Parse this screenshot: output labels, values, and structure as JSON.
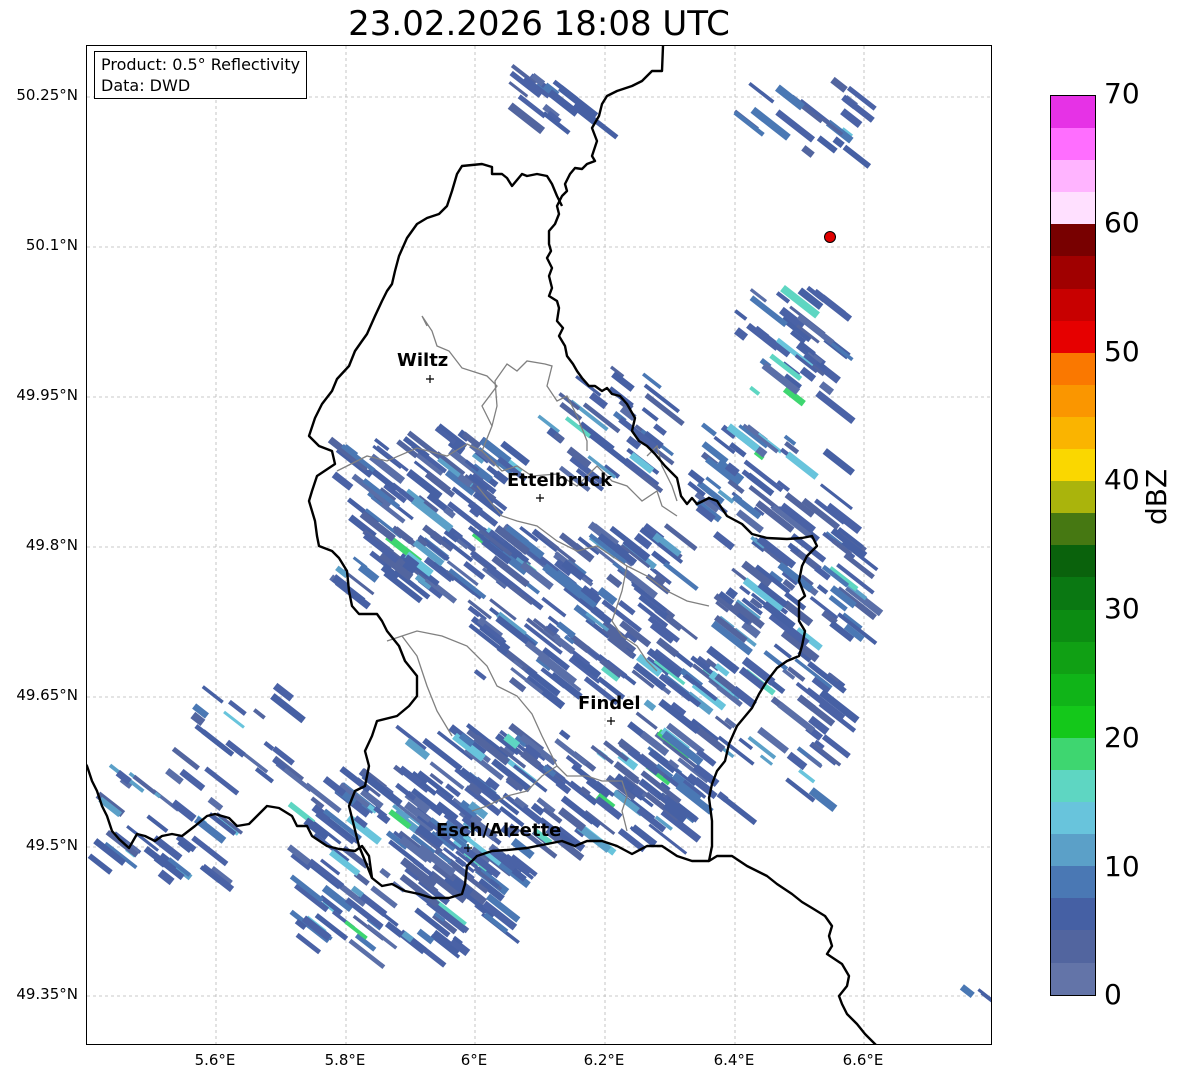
{
  "title": "23.02.2026 18:08 UTC",
  "info": {
    "product": "Product: 0.5° Reflectivity",
    "source": "Data: DWD"
  },
  "lat_labels": [
    "50.25°N",
    "50.1°N",
    "49.95°N",
    "49.8°N",
    "49.65°N",
    "49.5°N",
    "49.35°N"
  ],
  "lon_labels": [
    "5.6°E",
    "5.8°E",
    "6°E",
    "6.2°E",
    "6.4°E",
    "6.6°E"
  ],
  "cities": [
    {
      "name": "Wiltz"
    },
    {
      "name": "Ettelbruck"
    },
    {
      "name": "Findel"
    },
    {
      "name": "Esch/Alzette"
    }
  ],
  "colorbar": {
    "unit": "dBZ",
    "ticks": [
      "0",
      "10",
      "20",
      "30",
      "40",
      "50",
      "60",
      "70"
    ],
    "colors": [
      "#6374a8",
      "#52659f",
      "#4560a4",
      "#4a78b4",
      "#5ba0c8",
      "#68c4dc",
      "#5ed6c2",
      "#3ed670",
      "#14c81a",
      "#10b418",
      "#10a014",
      "#0c8c12",
      "#0a7812",
      "#0a620c",
      "#467812",
      "#aab40c",
      "#fad700",
      "#fab400",
      "#fa9600",
      "#fa7800",
      "#e60000",
      "#c80000",
      "#a00000",
      "#780000",
      "#ffe0ff",
      "#ffb4ff",
      "#ff6eff",
      "#e632e6"
    ]
  }
}
